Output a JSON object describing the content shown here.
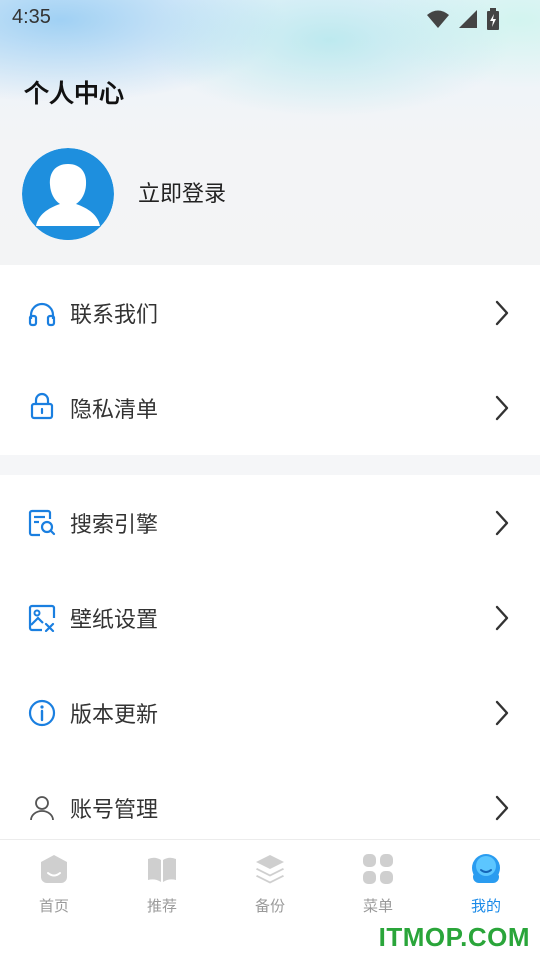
{
  "status_bar": {
    "time": "4:35"
  },
  "header": {
    "title": "个人中心",
    "login": "立即登录"
  },
  "menu": {
    "group1": [
      {
        "label": "联系我们",
        "icon": "headset-icon"
      },
      {
        "label": "隐私清单",
        "icon": "lock-icon"
      }
    ],
    "group2": [
      {
        "label": "搜索引擎",
        "icon": "search-document-icon"
      },
      {
        "label": "壁纸设置",
        "icon": "wallpaper-icon"
      },
      {
        "label": "版本更新",
        "icon": "info-icon"
      },
      {
        "label": "账号管理",
        "icon": "account-icon"
      }
    ]
  },
  "tabbar": {
    "items": [
      {
        "label": "首页",
        "icon": "home-icon"
      },
      {
        "label": "推荐",
        "icon": "book-icon"
      },
      {
        "label": "备份",
        "icon": "layers-icon"
      },
      {
        "label": "菜单",
        "icon": "grid-icon"
      },
      {
        "label": "我的",
        "icon": "profile-icon",
        "active": true
      }
    ]
  },
  "colors": {
    "accent": "#1a8ae8",
    "inactive": "#9a9a9a",
    "watermark": "#2aa53a"
  },
  "watermark": "ITMOP.COM"
}
